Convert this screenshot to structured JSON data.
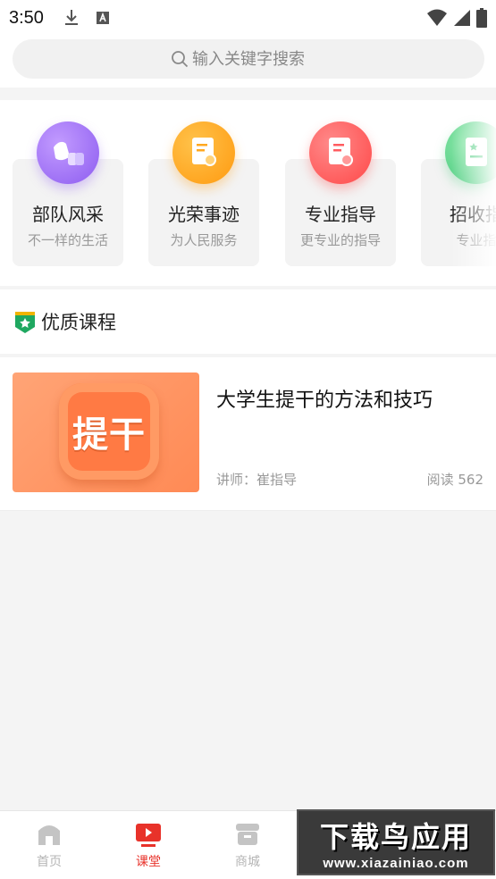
{
  "status_bar": {
    "time": "3:50"
  },
  "search": {
    "placeholder": "输入关键字搜索"
  },
  "categories": [
    {
      "title": "部队风采",
      "subtitle": "不一样的生活",
      "icon": "soldiers-icon",
      "color": "#a678f5"
    },
    {
      "title": "光荣事迹",
      "subtitle": "为人民服务",
      "icon": "certificate-icon",
      "color": "#ffa820"
    },
    {
      "title": "专业指导",
      "subtitle": "更专业的指导",
      "icon": "certificate-icon",
      "color": "#ff5c60"
    },
    {
      "title": "招收指",
      "subtitle": "专业指",
      "icon": "document-star-icon",
      "color": "#5cd08a"
    }
  ],
  "section": {
    "title": "优质课程"
  },
  "courses": [
    {
      "title": "大学生提干的方法和技巧",
      "thumb_text": "提干",
      "teacher": "讲师：崔指导",
      "reads": "阅读 562"
    }
  ],
  "tabs": [
    {
      "label": "首页",
      "icon": "home-icon",
      "active": false
    },
    {
      "label": "课堂",
      "icon": "play-screen-icon",
      "active": true
    },
    {
      "label": "商城",
      "icon": "store-icon",
      "active": false
    }
  ],
  "watermark": {
    "main": "下载鸟应用",
    "url": "www.xiazainiao.com"
  },
  "colors": {
    "accent": "#e8322a",
    "inactive": "#b5b5b5"
  }
}
